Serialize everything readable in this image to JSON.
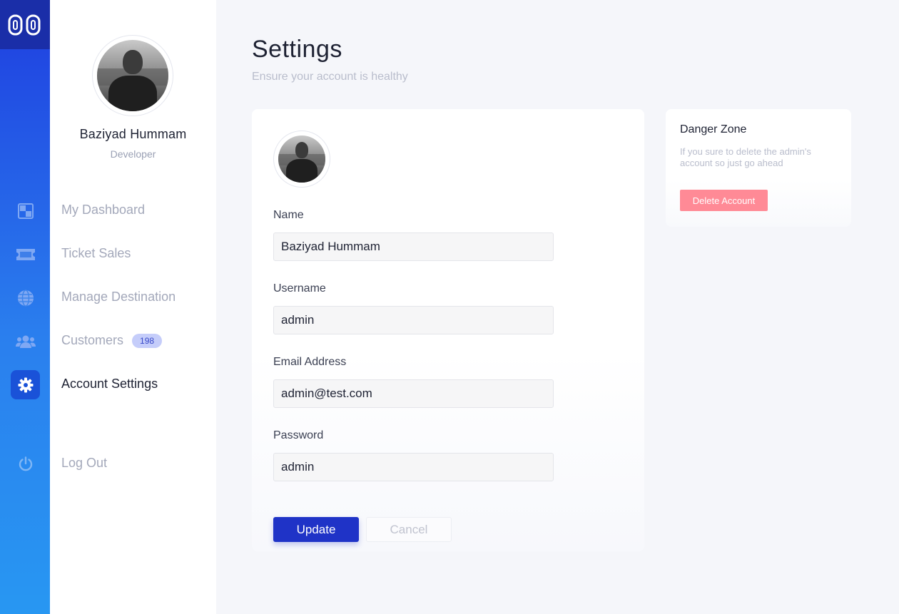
{
  "colors": {
    "accent": "#1f33c7",
    "rail_gradient_start": "#1f3ee0",
    "rail_gradient_end": "#2897f2",
    "danger": "#ff8a96",
    "badge_bg": "#c5cdfa"
  },
  "rail": {
    "logo_text": "00",
    "icons": [
      "dashboard-icon",
      "ticket-icon",
      "globe-icon",
      "users-icon",
      "gear-icon",
      "power-icon"
    ]
  },
  "profile": {
    "name": "Baziyad Hummam",
    "role": "Developer"
  },
  "nav": {
    "dashboard": "My Dashboard",
    "ticket_sales": "Ticket Sales",
    "manage_destination": "Manage Destination",
    "customers": "Customers",
    "customers_count": "198",
    "account_settings": "Account Settings",
    "log_out": "Log Out"
  },
  "page": {
    "title": "Settings",
    "subtitle": "Ensure your account is healthy"
  },
  "form": {
    "name_label": "Name",
    "name_value": "Baziyad Hummam",
    "username_label": "Username",
    "username_value": "admin",
    "email_label": "Email Address",
    "email_value": "admin@test.com",
    "password_label": "Password",
    "password_value": "admin",
    "update_label": "Update",
    "cancel_label": "Cancel"
  },
  "danger": {
    "title": "Danger Zone",
    "description": "If you sure to delete the admin's account so just go ahead",
    "delete_label": "Delete Account"
  }
}
